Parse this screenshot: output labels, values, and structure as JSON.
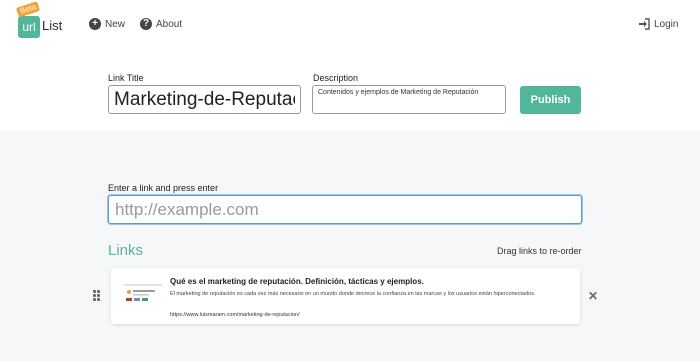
{
  "brand": {
    "beta": "Beta",
    "url": "url",
    "list": "List"
  },
  "nav": {
    "new": "New",
    "about": "About",
    "login": "Login"
  },
  "form": {
    "title_label": "Link Title",
    "title_value": "Marketing-de-Reputación",
    "description_label": "Description",
    "description_value": "Contenidos y ejemplos de Marketing de Reputación",
    "publish": "Publish"
  },
  "add_link": {
    "label": "Enter a link and press enter",
    "placeholder": "http://example.com"
  },
  "links": {
    "heading": "Links",
    "hint": "Drag links to re-order",
    "items": [
      {
        "title": "Qué es el marketing de reputación. Definición, tácticas y ejemplos.",
        "description": "El marketing de reputación es cada vez más necesario en un mundo donde decrece la confianza en las marcas y los usuarios están hiperconectados.",
        "url": "https://www.luismaram.com/marketing-de-reputacion/"
      }
    ]
  },
  "colors": {
    "accent": "#52b69a",
    "beta": "#f0a335",
    "focus": "#5b9bd5"
  }
}
